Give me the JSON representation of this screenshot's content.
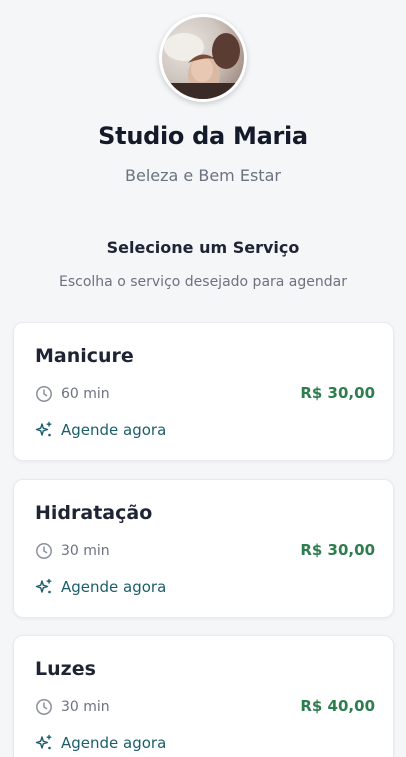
{
  "profile": {
    "avatar_icon": "profile-photo",
    "name": "Studio da Maria",
    "tagline": "Beleza e Bem Estar"
  },
  "services_section": {
    "title": "Selecione um Serviço",
    "subtitle": "Escolha o serviço desejado para agendar"
  },
  "services": [
    {
      "name": "Manicure",
      "duration": "60 min",
      "price": "R$ 30,00",
      "cta": "Agende agora"
    },
    {
      "name": "Hidratação",
      "duration": "30 min",
      "price": "R$ 30,00",
      "cta": "Agende agora"
    },
    {
      "name": "Luzes",
      "duration": "30 min",
      "price": "R$ 40,00",
      "cta": "Agende agora"
    }
  ],
  "colors": {
    "background": "#f5f6f8",
    "price": "#2e7d4f",
    "cta": "#1b5e6b",
    "muted_text": "#6b7280"
  },
  "icons": {
    "duration": "clock-icon",
    "cta": "sparkles-icon"
  }
}
